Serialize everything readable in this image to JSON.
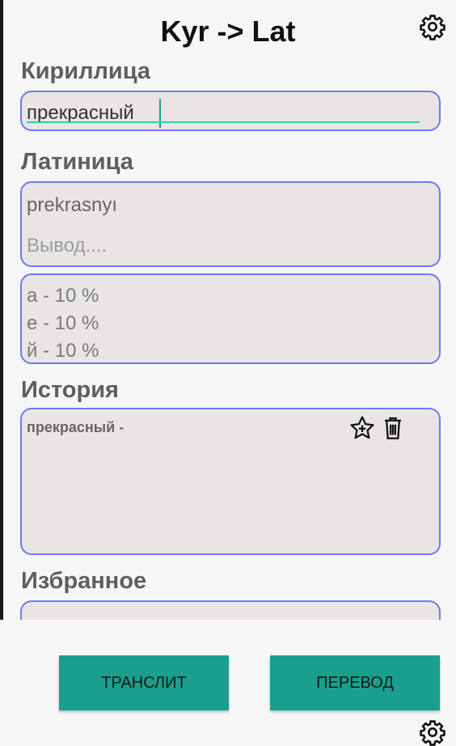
{
  "header": {
    "title": "Kyr -> Lat"
  },
  "cyrillic": {
    "label": "Кириллица",
    "input_value": "прекрасный"
  },
  "latin": {
    "label": "Латиница",
    "output_value": "prekrasnyı",
    "placeholder": "Вывод...."
  },
  "stats": [
    {
      "text": "а - 10 %"
    },
    {
      "text": "е - 10 %"
    },
    {
      "text": "й - 10 %"
    }
  ],
  "history": {
    "label": "История",
    "entry": "прекрасный -"
  },
  "favorites": {
    "label": "Избранное"
  },
  "buttons": {
    "translit": "ТРАНСЛИТ",
    "translate": "ПЕРЕВОД"
  },
  "colors": {
    "accent": "#1a9e8e",
    "box_border": "#6b7bf0",
    "box_fill": "#e9e5e5"
  }
}
